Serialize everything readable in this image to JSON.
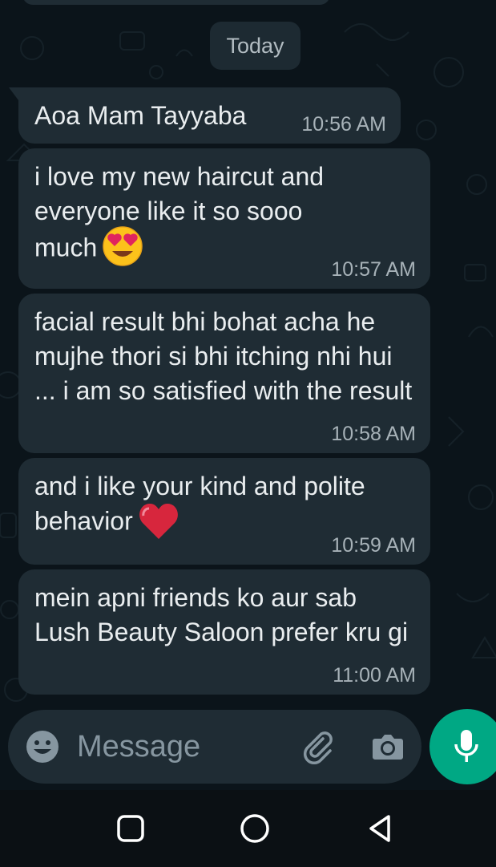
{
  "date_chip": "Today",
  "messages": [
    {
      "text": "Aoa Mam Tayyaba",
      "time": "10:56 AM"
    },
    {
      "text": "i love my new haircut and everyone like it so sooo much",
      "emoji": "heart-eyes-emoji",
      "time": "10:57 AM"
    },
    {
      "text": "facial result bhi bohat acha he mujhe thori si bhi itching nhi hui ... i am so satisfied with the result",
      "time": "10:58 AM"
    },
    {
      "text": "and i like your kind and polite behavior",
      "emoji": "red-heart-emoji",
      "time": "10:59 AM"
    },
    {
      "text": "mein apni friends ko aur sab Lush Beauty Saloon prefer kru gi",
      "time": "11:00 AM"
    }
  ],
  "composer": {
    "placeholder": "Message",
    "icons": [
      "emoji-icon",
      "attach-icon",
      "camera-icon",
      "mic-icon"
    ]
  },
  "nav": {
    "icons": [
      "recents-icon",
      "home-icon",
      "back-icon"
    ]
  },
  "colors": {
    "background": "#0b141a",
    "bubble": "#1f2c34",
    "accent": "#00a884",
    "text": "#e9edef",
    "timestamp": "#a7b2b8"
  }
}
